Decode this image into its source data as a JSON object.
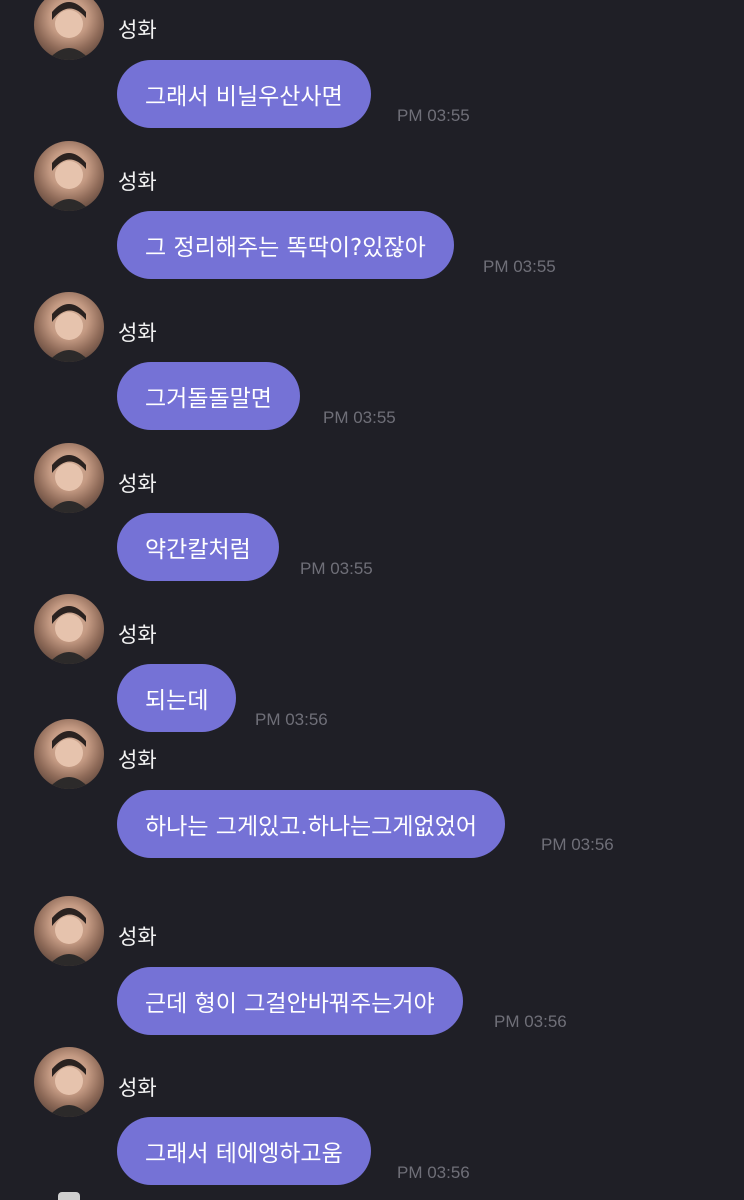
{
  "sender_name": "성화",
  "messages": [
    {
      "text": "그래서 비닐우산사면",
      "time": "PM 03:55"
    },
    {
      "text": "그 정리해주는 똑딱이?있잖아",
      "time": "PM 03:55"
    },
    {
      "text": "그거돌돌말면",
      "time": "PM 03:55"
    },
    {
      "text": "약간칼처럼",
      "time": "PM 03:55"
    },
    {
      "text": "되는데",
      "time": "PM 03:56"
    },
    {
      "text": "하나는 그게있고.하나는그게없었어",
      "time": "PM 03:56"
    },
    {
      "text": "근데 형이 그걸안바꿔주는거야",
      "time": "PM 03:56"
    },
    {
      "text": "그래서 테에엥하고움",
      "time": "PM 03:56"
    }
  ],
  "colors": {
    "background": "#1f1f26",
    "bubble": "#7572d6",
    "time": "#6f6f78"
  }
}
